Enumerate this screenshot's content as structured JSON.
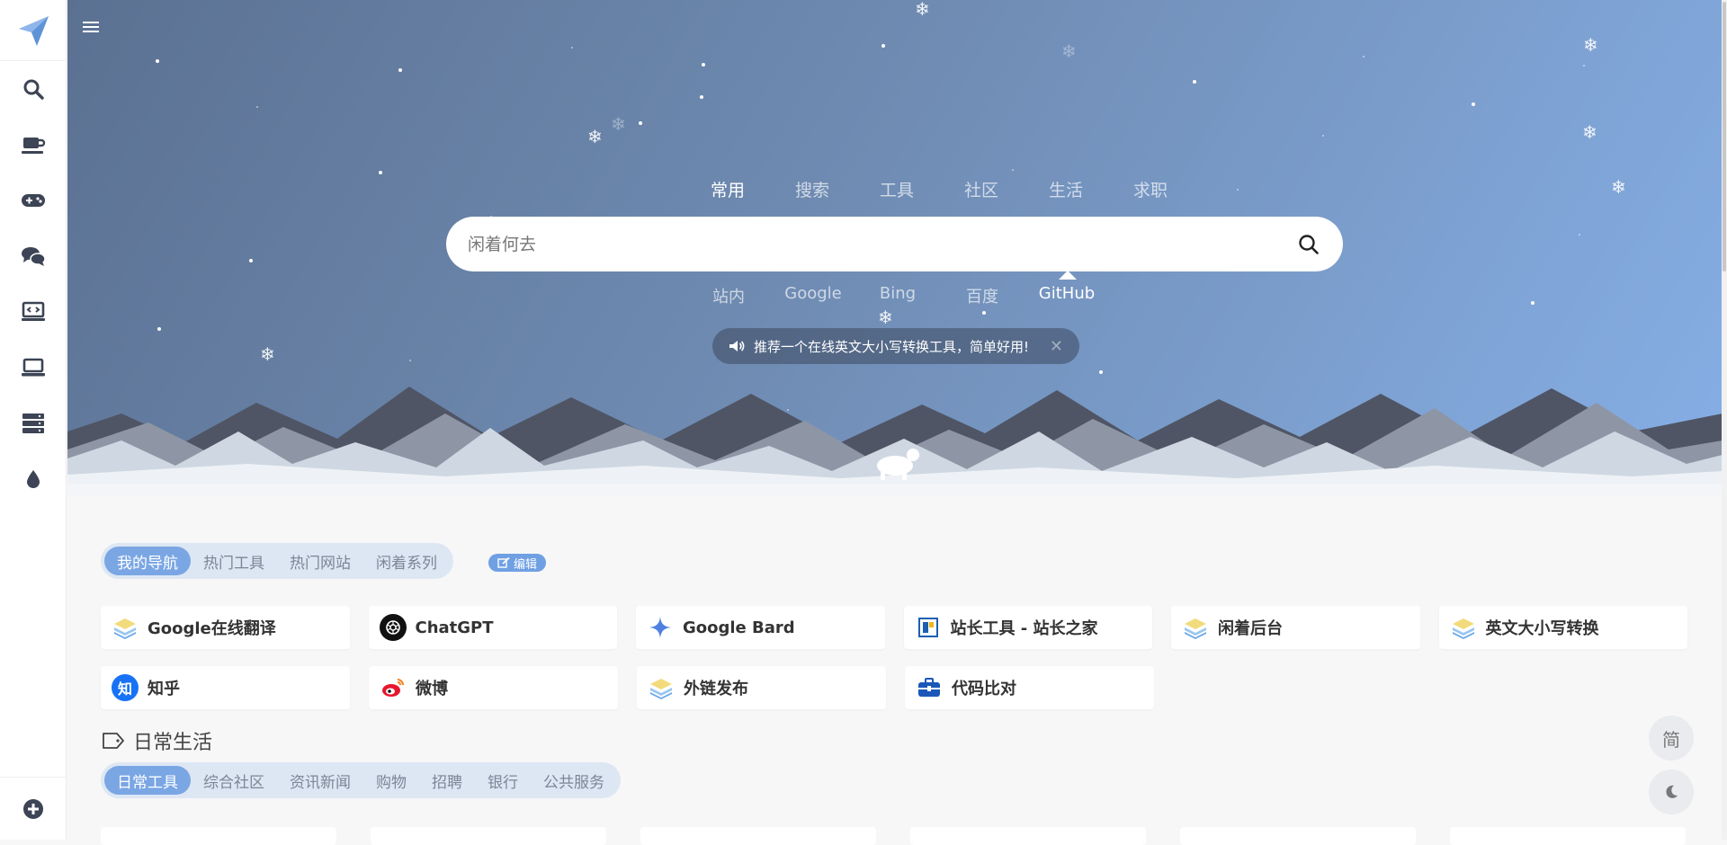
{
  "sidebar": {
    "logo": "paper-plane-logo",
    "items": [
      {
        "icon": "search-icon"
      },
      {
        "icon": "coffee-cup-icon"
      },
      {
        "icon": "gamepad-icon"
      },
      {
        "icon": "chat-bubbles-icon"
      },
      {
        "icon": "code-monitor-icon"
      },
      {
        "icon": "laptop-icon"
      },
      {
        "icon": "server-icon"
      },
      {
        "icon": "water-drop-icon"
      }
    ],
    "bottom_icon": "plus-circle-icon"
  },
  "hero": {
    "tabs": [
      "常用",
      "搜索",
      "工具",
      "社区",
      "生活",
      "求职"
    ],
    "active_tab": 0,
    "search_placeholder": "闲着何去",
    "engines": [
      "站内",
      "Google",
      "Bing",
      "百度",
      "GitHub"
    ],
    "active_engine": 4,
    "notice": "推荐一个在线英文大小写转换工具，简单好用!",
    "notice_close": "✕"
  },
  "nav_tabs": {
    "items": [
      "我的导航",
      "热门工具",
      "热门网站",
      "闲着系列"
    ],
    "active": 0,
    "edit_label": "编辑"
  },
  "links": [
    [
      {
        "name": "Google在线翻译",
        "icon": "stack-layers-icon"
      },
      {
        "name": "ChatGPT",
        "icon": "openai-icon"
      },
      {
        "name": "Google Bard",
        "icon": "sparkle-icon"
      },
      {
        "name": "站长工具 - 站长之家",
        "icon": "chinaz-icon"
      },
      {
        "name": "闲着后台",
        "icon": "stack-layers-icon"
      },
      {
        "name": "英文大小写转换",
        "icon": "stack-layers-icon"
      }
    ],
    [
      {
        "name": "知乎",
        "icon": "zhihu-icon"
      },
      {
        "name": "微博",
        "icon": "weibo-icon"
      },
      {
        "name": "外链发布",
        "icon": "stack-layers-icon"
      },
      {
        "name": "代码比对",
        "icon": "toolbox-icon"
      }
    ]
  ],
  "section": {
    "title": "日常生活",
    "tabs": [
      "日常工具",
      "综合社区",
      "资讯新闻",
      "购物",
      "招聘",
      "银行",
      "公共服务"
    ],
    "active": 0
  },
  "floating": {
    "lang_label": "简"
  },
  "colors": {
    "accent": "#7aa6e4",
    "hero_start": "#5b7192",
    "hero_end": "#86afe6"
  }
}
